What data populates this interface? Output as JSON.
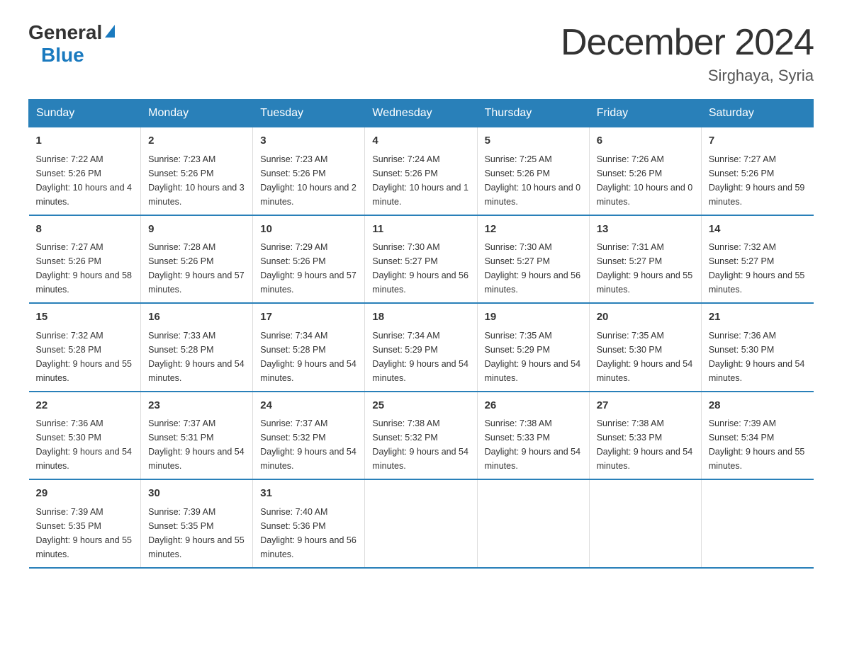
{
  "header": {
    "logo_general": "General",
    "logo_blue": "Blue",
    "month_title": "December 2024",
    "location": "Sirghaya, Syria"
  },
  "days_of_week": [
    "Sunday",
    "Monday",
    "Tuesday",
    "Wednesday",
    "Thursday",
    "Friday",
    "Saturday"
  ],
  "weeks": [
    [
      {
        "day": "1",
        "sunrise": "7:22 AM",
        "sunset": "5:26 PM",
        "daylight": "10 hours and 4 minutes."
      },
      {
        "day": "2",
        "sunrise": "7:23 AM",
        "sunset": "5:26 PM",
        "daylight": "10 hours and 3 minutes."
      },
      {
        "day": "3",
        "sunrise": "7:23 AM",
        "sunset": "5:26 PM",
        "daylight": "10 hours and 2 minutes."
      },
      {
        "day": "4",
        "sunrise": "7:24 AM",
        "sunset": "5:26 PM",
        "daylight": "10 hours and 1 minute."
      },
      {
        "day": "5",
        "sunrise": "7:25 AM",
        "sunset": "5:26 PM",
        "daylight": "10 hours and 0 minutes."
      },
      {
        "day": "6",
        "sunrise": "7:26 AM",
        "sunset": "5:26 PM",
        "daylight": "10 hours and 0 minutes."
      },
      {
        "day": "7",
        "sunrise": "7:27 AM",
        "sunset": "5:26 PM",
        "daylight": "9 hours and 59 minutes."
      }
    ],
    [
      {
        "day": "8",
        "sunrise": "7:27 AM",
        "sunset": "5:26 PM",
        "daylight": "9 hours and 58 minutes."
      },
      {
        "day": "9",
        "sunrise": "7:28 AM",
        "sunset": "5:26 PM",
        "daylight": "9 hours and 57 minutes."
      },
      {
        "day": "10",
        "sunrise": "7:29 AM",
        "sunset": "5:26 PM",
        "daylight": "9 hours and 57 minutes."
      },
      {
        "day": "11",
        "sunrise": "7:30 AM",
        "sunset": "5:27 PM",
        "daylight": "9 hours and 56 minutes."
      },
      {
        "day": "12",
        "sunrise": "7:30 AM",
        "sunset": "5:27 PM",
        "daylight": "9 hours and 56 minutes."
      },
      {
        "day": "13",
        "sunrise": "7:31 AM",
        "sunset": "5:27 PM",
        "daylight": "9 hours and 55 minutes."
      },
      {
        "day": "14",
        "sunrise": "7:32 AM",
        "sunset": "5:27 PM",
        "daylight": "9 hours and 55 minutes."
      }
    ],
    [
      {
        "day": "15",
        "sunrise": "7:32 AM",
        "sunset": "5:28 PM",
        "daylight": "9 hours and 55 minutes."
      },
      {
        "day": "16",
        "sunrise": "7:33 AM",
        "sunset": "5:28 PM",
        "daylight": "9 hours and 54 minutes."
      },
      {
        "day": "17",
        "sunrise": "7:34 AM",
        "sunset": "5:28 PM",
        "daylight": "9 hours and 54 minutes."
      },
      {
        "day": "18",
        "sunrise": "7:34 AM",
        "sunset": "5:29 PM",
        "daylight": "9 hours and 54 minutes."
      },
      {
        "day": "19",
        "sunrise": "7:35 AM",
        "sunset": "5:29 PM",
        "daylight": "9 hours and 54 minutes."
      },
      {
        "day": "20",
        "sunrise": "7:35 AM",
        "sunset": "5:30 PM",
        "daylight": "9 hours and 54 minutes."
      },
      {
        "day": "21",
        "sunrise": "7:36 AM",
        "sunset": "5:30 PM",
        "daylight": "9 hours and 54 minutes."
      }
    ],
    [
      {
        "day": "22",
        "sunrise": "7:36 AM",
        "sunset": "5:30 PM",
        "daylight": "9 hours and 54 minutes."
      },
      {
        "day": "23",
        "sunrise": "7:37 AM",
        "sunset": "5:31 PM",
        "daylight": "9 hours and 54 minutes."
      },
      {
        "day": "24",
        "sunrise": "7:37 AM",
        "sunset": "5:32 PM",
        "daylight": "9 hours and 54 minutes."
      },
      {
        "day": "25",
        "sunrise": "7:38 AM",
        "sunset": "5:32 PM",
        "daylight": "9 hours and 54 minutes."
      },
      {
        "day": "26",
        "sunrise": "7:38 AM",
        "sunset": "5:33 PM",
        "daylight": "9 hours and 54 minutes."
      },
      {
        "day": "27",
        "sunrise": "7:38 AM",
        "sunset": "5:33 PM",
        "daylight": "9 hours and 54 minutes."
      },
      {
        "day": "28",
        "sunrise": "7:39 AM",
        "sunset": "5:34 PM",
        "daylight": "9 hours and 55 minutes."
      }
    ],
    [
      {
        "day": "29",
        "sunrise": "7:39 AM",
        "sunset": "5:35 PM",
        "daylight": "9 hours and 55 minutes."
      },
      {
        "day": "30",
        "sunrise": "7:39 AM",
        "sunset": "5:35 PM",
        "daylight": "9 hours and 55 minutes."
      },
      {
        "day": "31",
        "sunrise": "7:40 AM",
        "sunset": "5:36 PM",
        "daylight": "9 hours and 56 minutes."
      },
      null,
      null,
      null,
      null
    ]
  ]
}
